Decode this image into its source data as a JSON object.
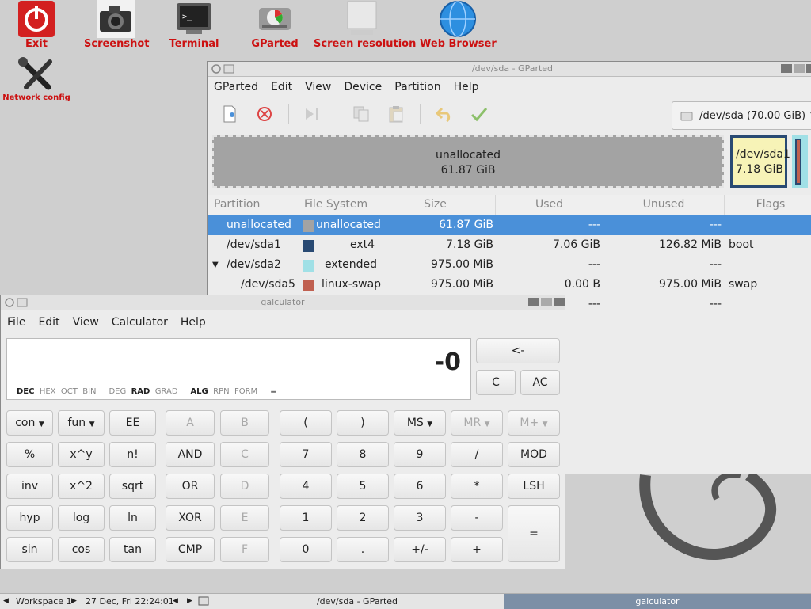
{
  "desktop": {
    "icons": [
      {
        "label": "Exit"
      },
      {
        "label": "Screenshot"
      },
      {
        "label": "Terminal"
      },
      {
        "label": "GParted"
      },
      {
        "label": "Screen resolution"
      },
      {
        "label": "Web Browser"
      },
      {
        "label": "Network config"
      }
    ]
  },
  "gparted": {
    "title": "/dev/sda - GParted",
    "menu": [
      "GParted",
      "Edit",
      "View",
      "Device",
      "Partition",
      "Help"
    ],
    "toolbar_icons": [
      "new-icon",
      "delete-icon",
      "resize-icon",
      "copy-icon",
      "paste-icon",
      "undo-icon",
      "apply-icon"
    ],
    "device_selector": "/dev/sda (70.00 GiB)",
    "map": {
      "unallocated_label": "unallocated",
      "unallocated_size": "61.87 GiB",
      "sda1_label": "/dev/sda1",
      "sda1_size": "7.18 GiB"
    },
    "columns": [
      "Partition",
      "File System",
      "Size",
      "Used",
      "Unused",
      "Flags"
    ],
    "rows": [
      {
        "partition": "unallocated",
        "fs": "unallocated",
        "fs_color": "#a3a3a3",
        "size": "61.87 GiB",
        "used": "---",
        "unused": "---",
        "flags": ""
      },
      {
        "partition": "/dev/sda1",
        "fs": "ext4",
        "fs_color": "#294a73",
        "size": "7.18 GiB",
        "used": "7.06 GiB",
        "unused": "126.82 MiB",
        "flags": "boot"
      },
      {
        "partition": "/dev/sda2",
        "fs": "extended",
        "fs_color": "#a0e0e6",
        "size": "975.00 MiB",
        "used": "---",
        "unused": "---",
        "flags": ""
      },
      {
        "partition": "/dev/sda5",
        "fs": "linux-swap",
        "fs_color": "#c06050",
        "size": "975.00 MiB",
        "used": "0.00 B",
        "unused": "975.00 MiB",
        "flags": "swap"
      },
      {
        "partition": "",
        "fs": "",
        "fs_color": "",
        "size": "",
        "used": "---",
        "unused": "---",
        "flags": ""
      }
    ]
  },
  "galculator": {
    "title": "galculator",
    "menu": [
      "File",
      "Edit",
      "View",
      "Calculator",
      "Help"
    ],
    "display_value": "-0",
    "modes": {
      "bases": [
        "DEC",
        "HEX",
        "OCT",
        "BIN"
      ],
      "angles": [
        "DEG",
        "RAD",
        "GRAD"
      ],
      "notation": [
        "ALG",
        "RPN",
        "FORM"
      ],
      "eq": "="
    },
    "buttons": {
      "backspace": "<-",
      "c": "C",
      "ac": "AC",
      "con": "con",
      "fun": "fun",
      "ee": "EE",
      "a": "A",
      "b": "B",
      "lparen": "(",
      "rparen": ")",
      "ms": "MS",
      "mr": "MR",
      "mplus": "M+",
      "percent": "%",
      "xpowy": "x^y",
      "fact": "n!",
      "and": "AND",
      "c_hex": "C",
      "seven": "7",
      "eight": "8",
      "nine": "9",
      "div": "/",
      "mod": "MOD",
      "inv": "inv",
      "xsq": "x^2",
      "sqrt": "sqrt",
      "or": "OR",
      "d": "D",
      "four": "4",
      "five": "5",
      "six": "6",
      "mul": "*",
      "lsh": "LSH",
      "hyp": "hyp",
      "log": "log",
      "ln": "ln",
      "xor": "XOR",
      "e": "E",
      "one": "1",
      "two": "2",
      "three": "3",
      "minus": "-",
      "equals": "=",
      "sin": "sin",
      "cos": "cos",
      "tan": "tan",
      "cmp": "CMP",
      "f": "F",
      "zero": "0",
      "dot": ".",
      "sign": "+/-",
      "plus": "+"
    }
  },
  "taskbar": {
    "workspace": "Workspace 1",
    "datetime": "27 Dec, Fri 22:24:01",
    "task1": "/dev/sda - GParted",
    "task2": "galculator"
  }
}
